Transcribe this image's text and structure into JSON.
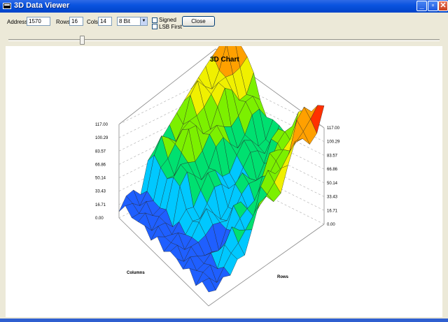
{
  "window": {
    "title": "3D Data Viewer",
    "icon": "app-icon",
    "minimize_icon": "minimize-icon",
    "maximize_icon": "maximize-icon",
    "close_icon": "close-icon",
    "minimize_glyph": "_",
    "maximize_glyph": "▫",
    "close_glyph": "✕"
  },
  "toolbar": {
    "address_label": "Address",
    "address_value": "1570",
    "rows_label": "Rows",
    "rows_value": "16",
    "cols_label": "Cols",
    "cols_value": "14",
    "bits_select_value": "8 Bit",
    "bits_arrow": "▼",
    "signed_label": "Signed",
    "signed_checked": false,
    "lsb_first_label": "LSB First",
    "lsb_first_checked": false,
    "close_button_label": "Close"
  },
  "slider": {
    "value_fraction": 0.17
  },
  "chart_data": {
    "type": "surface-3d",
    "title": "3D Chart",
    "x_axis_label": "Columns",
    "y_axis_label": "Rows",
    "z_ticks_left": [
      "117.00",
      "100.29",
      "83.57",
      "66.86",
      "50.14",
      "33.43",
      "16.71",
      "0.00"
    ],
    "z_ticks_right": [
      "117.00",
      "100.29",
      "83.57",
      "66.86",
      "50.14",
      "33.43",
      "16.71",
      "0.00"
    ],
    "zlim": [
      0,
      117
    ],
    "colors": [
      "#1f5fff",
      "#00c8ff",
      "#00e070",
      "#7cf000",
      "#f0f000",
      "#ffa000",
      "#ff3000"
    ]
  }
}
